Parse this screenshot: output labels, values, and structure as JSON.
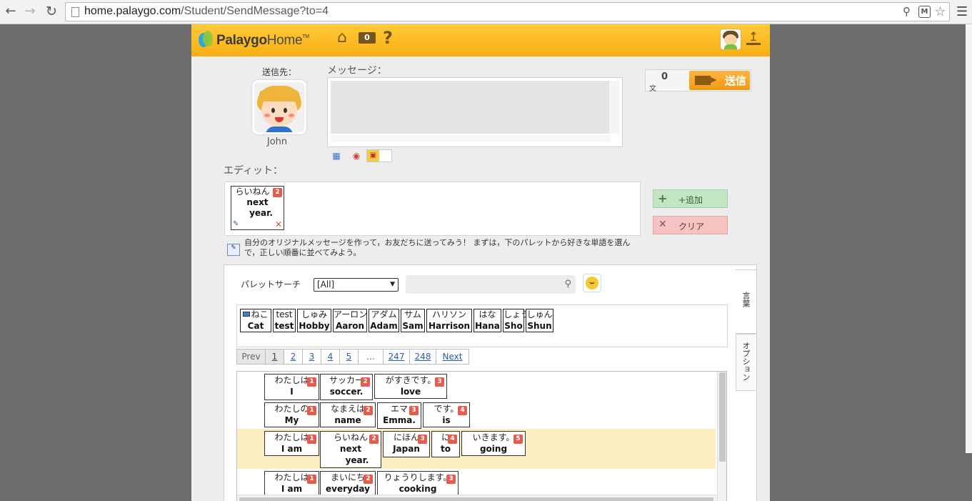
{
  "browser": {
    "url_host": "home.palaygo.com",
    "url_path": "/Student/SendMessage?to=4",
    "back_icon": "back-arrow-icon",
    "forward_icon": "forward-arrow-icon",
    "reload_icon": "reload-icon"
  },
  "header": {
    "logo_main": "Palaygo",
    "logo_home": "Home",
    "logo_tm": "TM",
    "mail_count": "0"
  },
  "recipient": {
    "label": "送信先：",
    "name": "John"
  },
  "message": {
    "label": "メッセージ：",
    "value": ""
  },
  "counter": {
    "count": "0",
    "unit": "文",
    "send_label": "送信"
  },
  "edit": {
    "label": "エディット：",
    "chip": {
      "jp": "らいねん",
      "en1": "next",
      "en2": "year.",
      "badge": "2"
    }
  },
  "buttons": {
    "add_label": "+追加",
    "clear_label": "クリア"
  },
  "hint": "自分のオリジナルメッセージを作って，お友だちに送ってみう！ まずは，下のパレットから好きな単語を選んで，正しい順番に並べてみよう。",
  "palette": {
    "search_label": "パレットサーチ",
    "select_value": "[All]",
    "search_placeholder": "",
    "tabs": [
      "言葉",
      "オプション"
    ],
    "words": [
      {
        "jp": "ねこ",
        "en": "Cat"
      },
      {
        "jp": "test",
        "en": "test"
      },
      {
        "jp": "しゅみ",
        "en": "Hobby"
      },
      {
        "jp": "アーロン",
        "en": "Aaron"
      },
      {
        "jp": "アダム",
        "en": "Adam"
      },
      {
        "jp": "サム",
        "en": "Sam"
      },
      {
        "jp": "ハリソン",
        "en": "Harrison"
      },
      {
        "jp": "はな",
        "en": "Hana"
      },
      {
        "jp": "しょう",
        "en": "Sho"
      },
      {
        "jp": "しゅん",
        "en": "Shun"
      }
    ],
    "pager": [
      "Prev",
      "1",
      "2",
      "3",
      "4",
      "5",
      "...",
      "247",
      "248",
      "Next"
    ]
  },
  "sentences": [
    [
      {
        "jp": "わたしは",
        "en": "I",
        "badge": "1"
      },
      {
        "jp": "サッカー",
        "en": "soccer.",
        "badge": "2"
      },
      {
        "jp": "がすきです。",
        "en": "love",
        "badge": "3"
      }
    ],
    [
      {
        "jp": "わたしの",
        "en": "My",
        "badge": "1"
      },
      {
        "jp": "なまえは",
        "en": "name",
        "badge": "2"
      },
      {
        "jp": "エマ",
        "en": "Emma.",
        "badge": "3"
      },
      {
        "jp": "です。",
        "en": "is",
        "badge": "4"
      }
    ],
    [
      {
        "jp": "わたしは",
        "en": "I am",
        "badge": "1"
      },
      {
        "jp": "らいねん",
        "en": "next",
        "en2": "year.",
        "badge": "2"
      },
      {
        "jp": "にほん",
        "en": "Japan",
        "badge": "3"
      },
      {
        "jp": "に",
        "en": "to",
        "badge": "4"
      },
      {
        "jp": "いきます。",
        "en": "going",
        "badge": "5"
      }
    ],
    [
      {
        "jp": "わたしは",
        "en": "I am",
        "badge": "1"
      },
      {
        "jp": "まいにち",
        "en": "everyday",
        "badge": "2"
      },
      {
        "jp": "りょうりします。",
        "en": "cooking",
        "badge": "3"
      }
    ]
  ]
}
